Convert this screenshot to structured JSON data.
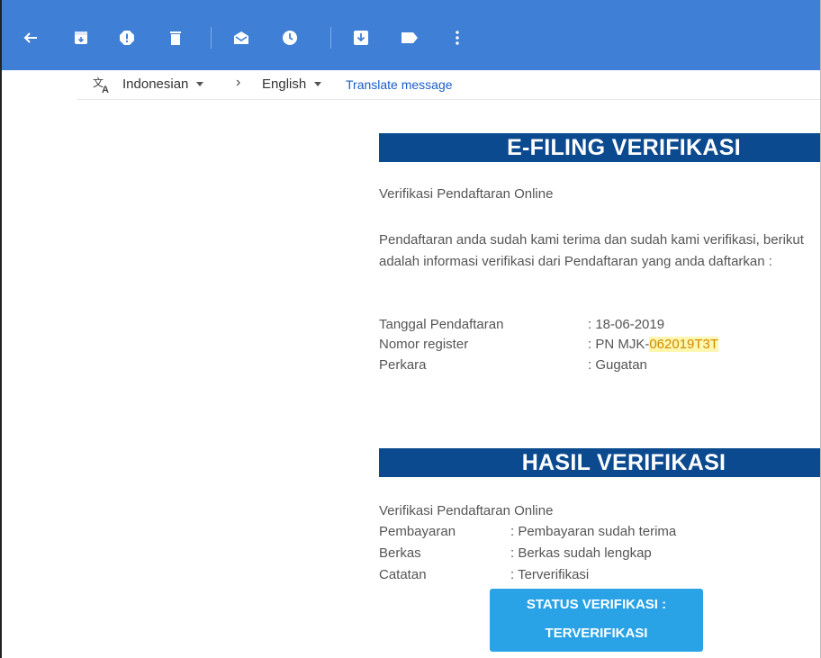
{
  "toolbar": {
    "icons": [
      "back-arrow-icon",
      "archive-icon",
      "report-spam-icon",
      "delete-icon",
      "mark-unread-icon",
      "snooze-icon",
      "move-to-icon",
      "label-icon",
      "more-vert-icon"
    ],
    "background": "#3f7fd6"
  },
  "translate": {
    "source_lang": "Indonesian",
    "target_lang": "English",
    "link": "Translate message"
  },
  "email": {
    "banner1": "E-FILING VERIFIKASI",
    "subtitle1": "Verifikasi Pendaftaran Online",
    "paragraph": "Pendaftaran anda sudah kami terima dan sudah kami verifikasi, berikut adalah informasi verifikasi dari Pendaftaran yang anda daftarkan :",
    "info": [
      {
        "label": "Tanggal Pendaftaran",
        "value": ": 18-06-2019"
      },
      {
        "label": "Nomor register",
        "value_prefix": ": PN MJK-",
        "value_highlight": "062019T3T"
      },
      {
        "label": "Perkara",
        "value": ": Gugatan"
      }
    ],
    "banner2": "HASIL VERIFIKASI",
    "subtitle2": "Verifikasi Pendaftaran Online",
    "results": [
      {
        "label": "Pembayaran",
        "value": ": Pembayaran sudah terima"
      },
      {
        "label": "Berkas",
        "value": ": Berkas sudah lengkap"
      },
      {
        "label": "Catatan",
        "value": ": Terverifikasi"
      }
    ],
    "status_line1": "STATUS VERIFIKASI :",
    "status_line2": "TERVERIFIKASI",
    "colors": {
      "banner": "#0c4a8f",
      "status_button": "#29a3e6",
      "highlight_bg": "#fff6b0",
      "highlight_text": "#d08a00"
    }
  }
}
